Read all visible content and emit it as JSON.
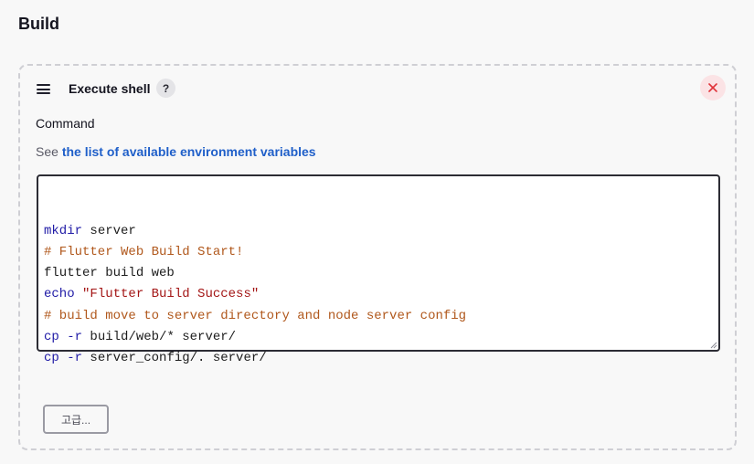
{
  "section": {
    "title": "Build"
  },
  "step": {
    "title": "Execute shell",
    "help_icon": "question-mark-icon",
    "help_glyph": "?",
    "close_icon": "close-icon",
    "drag_icon": "hamburger-drag-icon"
  },
  "command": {
    "label": "Command",
    "help_prefix": "See ",
    "help_link": "the list of available environment variables",
    "lines": [
      {
        "parts": [
          {
            "t": "kw",
            "v": "mkdir"
          },
          {
            "t": "tx",
            "v": " server"
          }
        ]
      },
      {
        "parts": [
          {
            "t": "cm",
            "v": "# Flutter Web Build Start!"
          }
        ]
      },
      {
        "parts": [
          {
            "t": "tx",
            "v": "flutter build web"
          }
        ]
      },
      {
        "parts": [
          {
            "t": "kw",
            "v": "echo"
          },
          {
            "t": "tx",
            "v": " "
          },
          {
            "t": "st",
            "v": "\"Flutter Build Success\""
          }
        ]
      },
      {
        "parts": [
          {
            "t": "cm",
            "v": "# build move to server directory and node server config"
          }
        ]
      },
      {
        "parts": [
          {
            "t": "kw",
            "v": "cp"
          },
          {
            "t": "tx",
            "v": " "
          },
          {
            "t": "kw",
            "v": "-r"
          },
          {
            "t": "tx",
            "v": " build/web/* server/"
          }
        ]
      },
      {
        "parts": [
          {
            "t": "kw",
            "v": "cp"
          },
          {
            "t": "tx",
            "v": " "
          },
          {
            "t": "kw",
            "v": "-r"
          },
          {
            "t": "tx",
            "v": " server_config/. server/"
          }
        ]
      }
    ]
  },
  "advanced_button": {
    "label": "고급..."
  },
  "colors": {
    "link": "#1f5fc9",
    "keyword": "#1f1aa6",
    "comment": "#b0571b",
    "string": "#a31515",
    "close": "#e0333a"
  }
}
